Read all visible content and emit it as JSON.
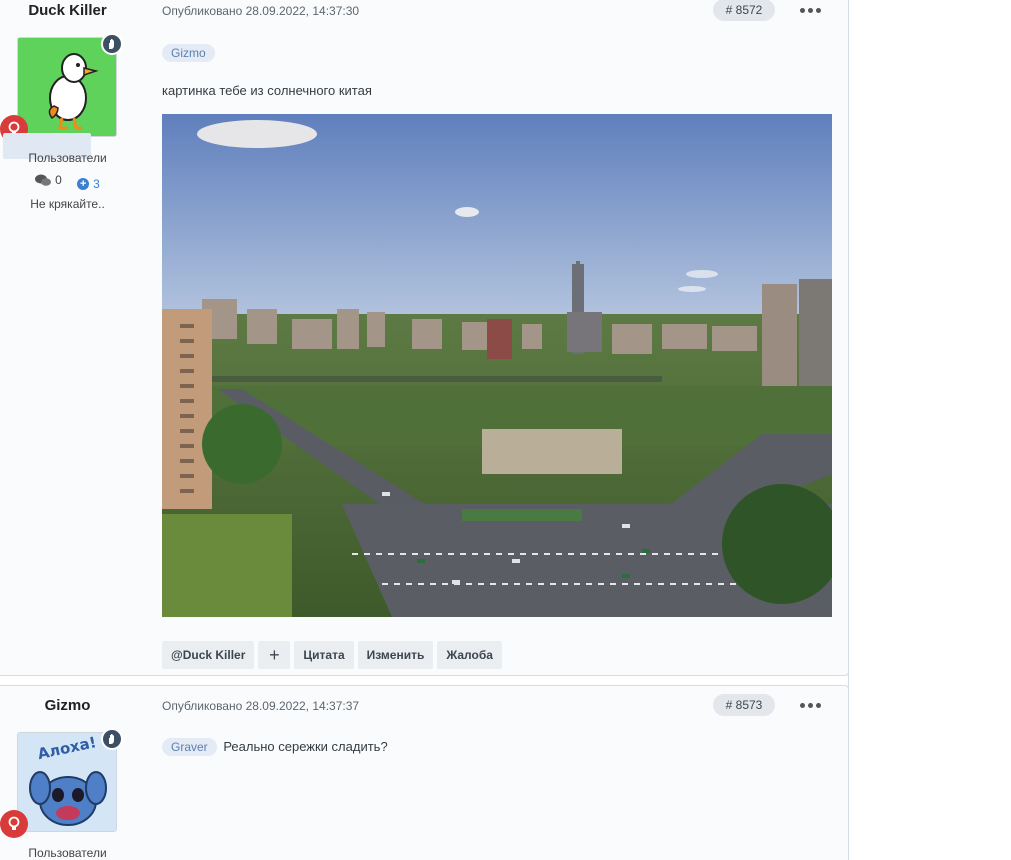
{
  "posts": [
    {
      "author": "Duck Killer",
      "group": "Пользователи",
      "posts_count": "0",
      "reputation": "3",
      "user_title": "Не крякайте..",
      "published": "Опубликовано 28.09.2022, 14:37:30",
      "number": "# 8572",
      "mention": "Gizmo",
      "text": "картинка тебе из солнечного китая",
      "actions": {
        "mention": "@Duck Killer",
        "plus": "+",
        "quote": "Цитата",
        "edit": "Изменить",
        "report": "Жалоба"
      }
    },
    {
      "author": "Gizmo",
      "group": "Пользователи",
      "published": "Опубликовано 28.09.2022, 14:37:37",
      "number": "# 8573",
      "mention": "Graver",
      "text": "Реально сережки сладить?",
      "avatar_text": "Алоха!"
    }
  ],
  "icons": {
    "hand": "hand-icon",
    "bulb": "lightbulb-icon",
    "comments": "comments-icon",
    "more": "more-icon"
  },
  "colors": {
    "accent": "#3a7fd1",
    "badge_red": "#d93b3b",
    "badge_dark": "#3d4f63"
  }
}
